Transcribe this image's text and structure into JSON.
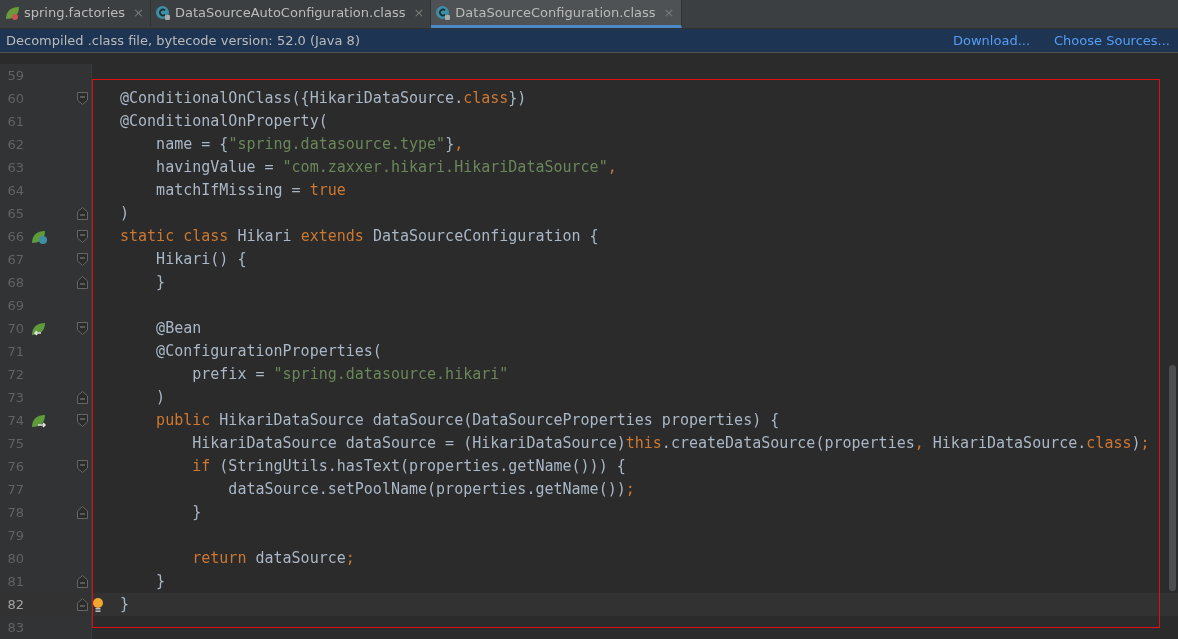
{
  "tabs": [
    {
      "label": "spring.factories",
      "kind": "spring",
      "close": "×",
      "selected": false
    },
    {
      "label": "DataSourceAutoConfiguration.class",
      "kind": "class",
      "close": "×",
      "selected": false
    },
    {
      "label": "DataSourceConfiguration.class",
      "kind": "class",
      "close": "×",
      "selected": true
    }
  ],
  "notice": {
    "text": "Decompiled .class file, bytecode version: 52.0 (Java 8)",
    "links": [
      "Download...",
      "Choose Sources..."
    ]
  },
  "editor": {
    "lines": [
      {
        "number": "59",
        "current": false
      },
      {
        "number": "60",
        "current": false,
        "gutter": [
          {
            "kind": "fold-start"
          }
        ],
        "tokens": [
          {
            "kind": "text",
            "text": "@ConditionalOnClass({HikariDataSource."
          },
          {
            "kind": "keyword",
            "text": "class"
          },
          {
            "kind": "text",
            "text": "})"
          }
        ]
      },
      {
        "number": "61",
        "current": false,
        "tokens": [
          {
            "kind": "text",
            "text": "@ConditionalOnProperty("
          }
        ]
      },
      {
        "number": "62",
        "current": false,
        "tokens": [
          {
            "kind": "text",
            "text": "    name = {"
          },
          {
            "kind": "string",
            "text": "\"spring.datasource.type\""
          },
          {
            "kind": "text",
            "text": "}"
          },
          {
            "kind": "keyword",
            "text": ","
          }
        ]
      },
      {
        "number": "63",
        "current": false,
        "tokens": [
          {
            "kind": "text",
            "text": "    havingValue = "
          },
          {
            "kind": "string",
            "text": "\"com.zaxxer.hikari.HikariDataSource\""
          },
          {
            "kind": "keyword",
            "text": ","
          }
        ]
      },
      {
        "number": "64",
        "current": false,
        "tokens": [
          {
            "kind": "text",
            "text": "    matchIfMissing = "
          },
          {
            "kind": "keyword",
            "text": "true"
          }
        ]
      },
      {
        "number": "65",
        "current": false,
        "gutter": [
          {
            "kind": "fold-end"
          }
        ],
        "tokens": [
          {
            "kind": "text",
            "text": ")"
          }
        ]
      },
      {
        "number": "66",
        "current": false,
        "gutter": [
          {
            "kind": "bean-class"
          },
          {
            "kind": "fold-start"
          }
        ],
        "tokens": [
          {
            "kind": "keyword",
            "text": "static class "
          },
          {
            "kind": "text",
            "text": "Hikari "
          },
          {
            "kind": "keyword",
            "text": "extends "
          },
          {
            "kind": "text",
            "text": "DataSourceConfiguration {"
          }
        ]
      },
      {
        "number": "67",
        "current": false,
        "gutter": [
          {
            "kind": "fold-start"
          }
        ],
        "tokens": [
          {
            "kind": "text",
            "text": "    Hikari() {"
          }
        ]
      },
      {
        "number": "68",
        "current": false,
        "gutter": [
          {
            "kind": "fold-end"
          }
        ],
        "tokens": [
          {
            "kind": "text",
            "text": "    }"
          }
        ]
      },
      {
        "number": "69",
        "current": false
      },
      {
        "number": "70",
        "current": false,
        "gutter": [
          {
            "kind": "bean-in"
          },
          {
            "kind": "fold-start"
          }
        ],
        "tokens": [
          {
            "kind": "text",
            "text": "    @Bean"
          }
        ]
      },
      {
        "number": "71",
        "current": false,
        "tokens": [
          {
            "kind": "text",
            "text": "    @ConfigurationProperties("
          }
        ]
      },
      {
        "number": "72",
        "current": false,
        "tokens": [
          {
            "kind": "text",
            "text": "        prefix = "
          },
          {
            "kind": "string",
            "text": "\"spring.datasource.hikari\""
          }
        ]
      },
      {
        "number": "73",
        "current": false,
        "gutter": [
          {
            "kind": "fold-end"
          }
        ],
        "tokens": [
          {
            "kind": "text",
            "text": "    )"
          }
        ]
      },
      {
        "number": "74",
        "current": false,
        "gutter": [
          {
            "kind": "bean-out"
          },
          {
            "kind": "fold-start"
          }
        ],
        "tokens": [
          {
            "kind": "keyword",
            "text": "    public "
          },
          {
            "kind": "text",
            "text": "HikariDataSource dataSource(DataSourceProperties properties) {"
          }
        ]
      },
      {
        "number": "75",
        "current": false,
        "tokens": [
          {
            "kind": "text",
            "text": "        HikariDataSource dataSource = (HikariDataSource)"
          },
          {
            "kind": "keyword",
            "text": "this"
          },
          {
            "kind": "text",
            "text": ".createDataSource(properties"
          },
          {
            "kind": "keyword",
            "text": ", "
          },
          {
            "kind": "text",
            "text": "HikariDataSource."
          },
          {
            "kind": "keyword",
            "text": "class"
          },
          {
            "kind": "text",
            "text": ")"
          },
          {
            "kind": "keyword",
            "text": ";"
          }
        ]
      },
      {
        "number": "76",
        "current": false,
        "gutter": [
          {
            "kind": "fold-start"
          }
        ],
        "tokens": [
          {
            "kind": "keyword",
            "text": "        if "
          },
          {
            "kind": "text",
            "text": "(StringUtils.hasText(properties.getName())) {"
          }
        ]
      },
      {
        "number": "77",
        "current": false,
        "tokens": [
          {
            "kind": "text",
            "text": "            dataSource.setPoolName(properties.getName())"
          },
          {
            "kind": "keyword",
            "text": ";"
          }
        ]
      },
      {
        "number": "78",
        "current": false,
        "gutter": [
          {
            "kind": "fold-end"
          }
        ],
        "tokens": [
          {
            "kind": "text",
            "text": "        }"
          }
        ]
      },
      {
        "number": "79",
        "current": false
      },
      {
        "number": "80",
        "current": false,
        "tokens": [
          {
            "kind": "keyword",
            "text": "        return "
          },
          {
            "kind": "text",
            "text": "dataSource"
          },
          {
            "kind": "keyword",
            "text": ";"
          }
        ]
      },
      {
        "number": "81",
        "current": false,
        "gutter": [
          {
            "kind": "fold-end"
          }
        ],
        "tokens": [
          {
            "kind": "text",
            "text": "    }"
          }
        ]
      },
      {
        "number": "82",
        "current": true,
        "gutter": [
          {
            "kind": "fold-end"
          },
          {
            "kind": "bulb"
          }
        ],
        "tokens": [
          {
            "kind": "text",
            "text": "}"
          }
        ]
      },
      {
        "number": "83",
        "current": false
      }
    ]
  }
}
